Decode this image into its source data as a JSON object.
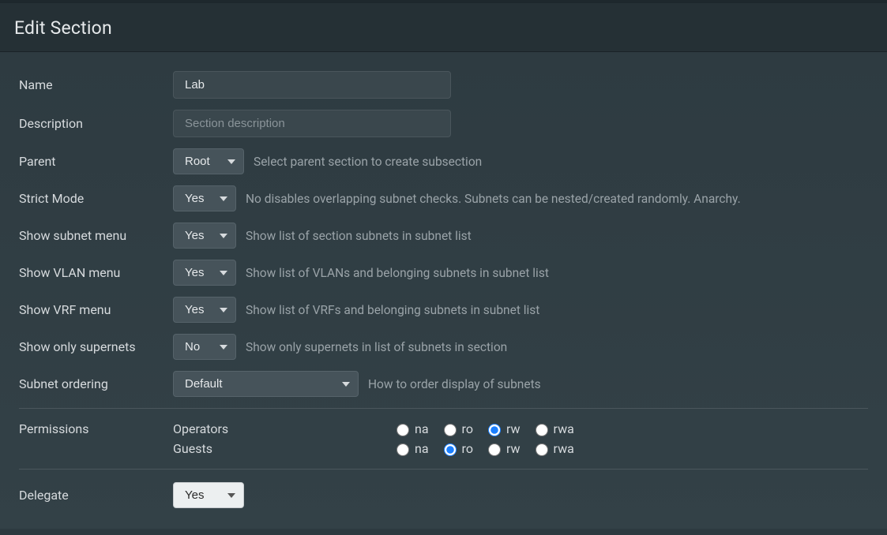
{
  "header": {
    "title": "Edit Section"
  },
  "labels": {
    "name": "Name",
    "description": "Description",
    "parent": "Parent",
    "strict": "Strict Mode",
    "subnetmenu": "Show subnet menu",
    "vlanmenu": "Show VLAN menu",
    "vrfmenu": "Show VRF menu",
    "supernets": "Show only supernets",
    "ordering": "Subnet ordering",
    "permissions": "Permissions",
    "delegate": "Delegate"
  },
  "values": {
    "name": "Lab",
    "description_placeholder": "Section description",
    "parent": "Root",
    "strict": "Yes",
    "subnetmenu": "Yes",
    "vlanmenu": "Yes",
    "vrfmenu": "Yes",
    "supernets": "No",
    "ordering": "Default",
    "delegate": "Yes"
  },
  "helpers": {
    "parent": "Select parent section to create subsection",
    "strict": "No disables overlapping subnet checks. Subnets can be nested/created randomly. Anarchy.",
    "subnetmenu": "Show list of section subnets in subnet list",
    "vlanmenu": "Show list of VLANs and belonging subnets in subnet list",
    "vrfmenu": "Show list of VRFs and belonging subnets in subnet list",
    "supernets": "Show only supernets in list of subnets in section",
    "ordering": "How to order display of subnets"
  },
  "permissions": {
    "options": {
      "na": "na",
      "ro": "ro",
      "rw": "rw",
      "rwa": "rwa"
    },
    "roles": [
      {
        "name": "Operators",
        "selected": "rw"
      },
      {
        "name": "Guests",
        "selected": "ro"
      }
    ]
  }
}
